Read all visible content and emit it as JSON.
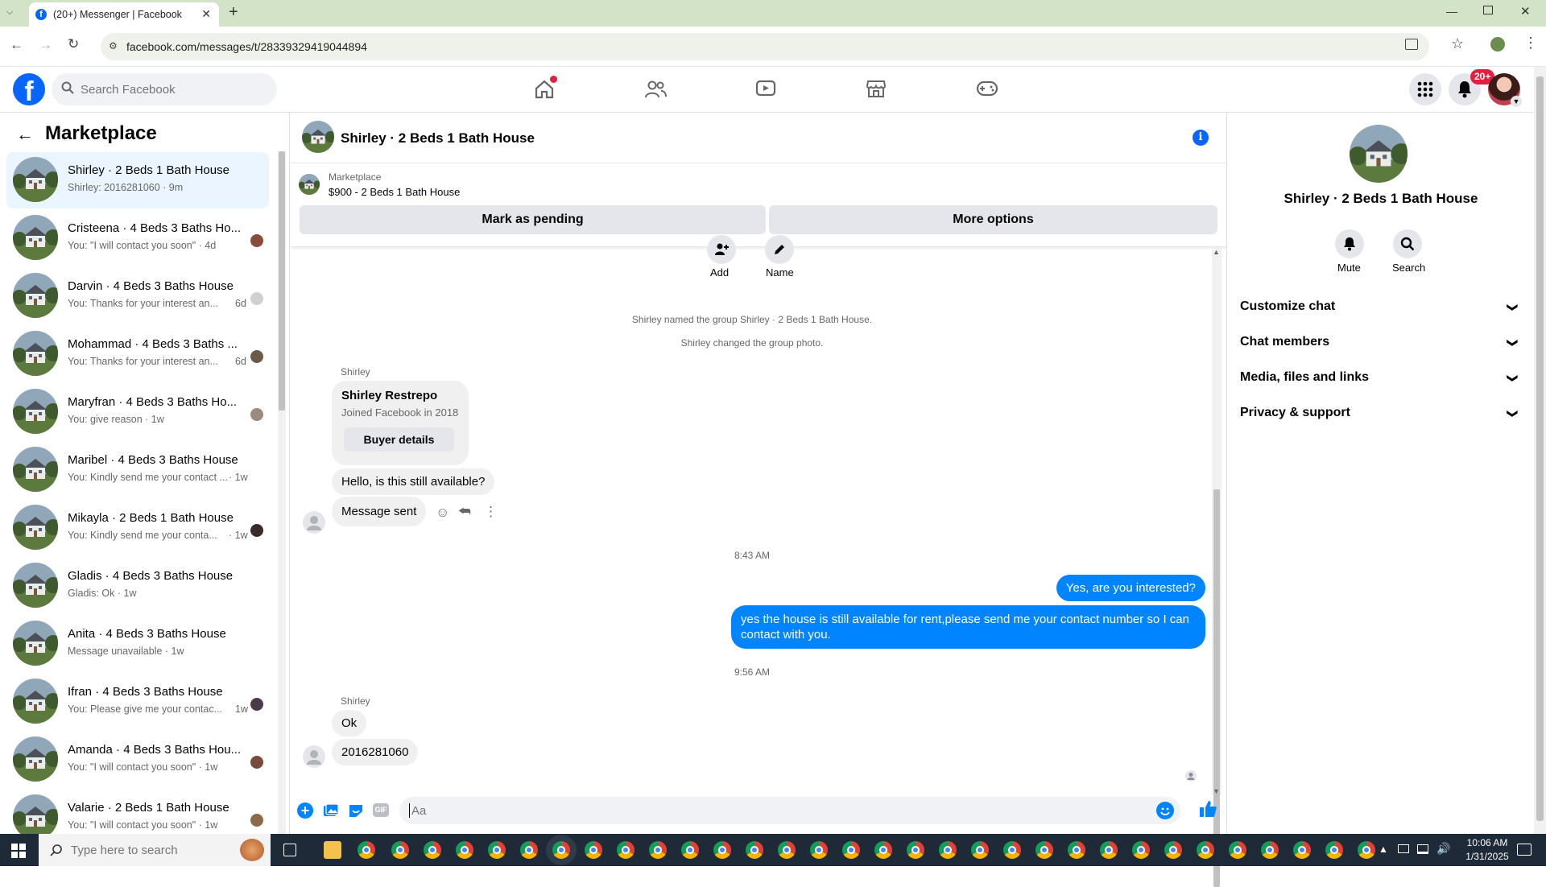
{
  "browser": {
    "tab_title": "(20+) Messenger | Facebook",
    "url": "facebook.com/messages/t/28339329419044894"
  },
  "fb_header": {
    "search_placeholder": "Search Facebook",
    "notif_badge": "20+"
  },
  "left_panel": {
    "title": "Marketplace",
    "conversations": [
      {
        "title": "Shirley · 2 Beds 1 Bath House",
        "snippet": "Shirley: 2016281060 · 9m",
        "active": true
      },
      {
        "title": "Cristeena · 4 Beds 3 Baths Ho...",
        "snippet": "You: \"I will contact you soon\" · 4d"
      },
      {
        "title": "Darvin · 4 Beds 3 Baths House",
        "snippet": "You: Thanks for your interest an...",
        "time": "6d"
      },
      {
        "title": "Mohammad · 4 Beds 3 Baths ...",
        "snippet": "You: Thanks for your interest an...",
        "time": "6d"
      },
      {
        "title": "Maryfran · 4 Beds 3 Baths Ho...",
        "snippet": "You: give reason · 1w"
      },
      {
        "title": "Maribel · 4 Beds 3 Baths House",
        "snippet": "You: Kindly send me your contact ...",
        "time": "· 1w"
      },
      {
        "title": "Mikayla · 2 Beds 1 Bath House",
        "snippet": "You: Kindly send me your conta...",
        "time": "· 1w"
      },
      {
        "title": "Gladis · 4 Beds 3 Baths House",
        "snippet": "Gladis: Ok · 1w"
      },
      {
        "title": "Anita · 4 Beds 3 Baths House",
        "snippet": "Message unavailable · 1w"
      },
      {
        "title": "Ifran · 4 Beds 3 Baths House",
        "snippet": "You: Please give me your contac...",
        "time": "1w"
      },
      {
        "title": "Amanda · 4 Beds 3 Baths Hou...",
        "snippet": "You: \"I will contact you soon\" · 1w"
      },
      {
        "title": "Valarie · 2 Beds 1 Bath House",
        "snippet": "You: \"I will contact you soon\" · 1w"
      }
    ]
  },
  "chat": {
    "header_title": "Shirley · 2 Beds 1 Bath House",
    "listing_label": "Marketplace",
    "listing_price": "$900 - 2 Beds 1 Bath House",
    "mark_pending": "Mark as pending",
    "more_options": "More options",
    "add_label": "Add",
    "name_label": "Name",
    "system_msg_1": "Shirley named the group Shirley · 2 Beds 1 Bath House.",
    "system_msg_2": "Shirley changed the group photo.",
    "sender_1": "Shirley",
    "card_name": "Shirley Restrepo",
    "card_sub": "Joined Facebook in 2018",
    "buyer_details": "Buyer details",
    "msg_1": "Hello, is this still available?",
    "msg_2": "Message sent",
    "time_1": "8:43 AM",
    "out_1": "Yes, are you interested?",
    "out_2": "yes the house is still available for rent,please send me your contact number so I can contact with you.",
    "time_2": "9:56 AM",
    "sender_2": "Shirley",
    "msg_3": "Ok",
    "msg_4": "2016281060",
    "composer_placeholder": "Aa"
  },
  "right_panel": {
    "name": "Shirley · 2 Beds 1 Bath House",
    "mute": "Mute",
    "search": "Search",
    "sections": [
      "Customize chat",
      "Chat members",
      "Media, files and links",
      "Privacy & support"
    ]
  },
  "taskbar": {
    "search_placeholder": "Type here to search",
    "time": "10:06 AM",
    "date": "1/31/2025"
  },
  "colors": {
    "fb_blue": "#0866ff",
    "messenger_blue": "#0084ff",
    "notif_red": "#e41e3f"
  }
}
